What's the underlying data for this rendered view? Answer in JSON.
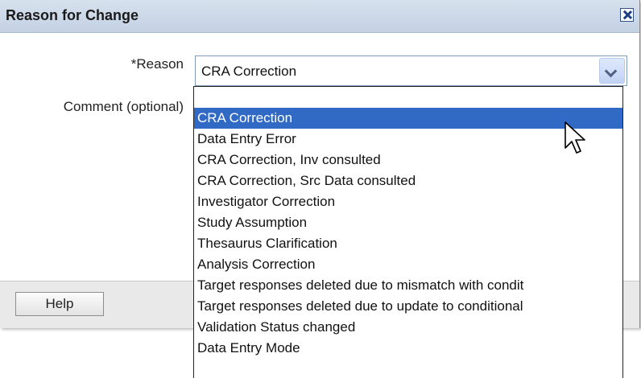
{
  "dialog": {
    "title": "Reason for Change",
    "close_icon": "close-icon"
  },
  "form": {
    "reason_label": "*Reason",
    "comment_label": "Comment (optional)",
    "reason_select": {
      "value": "CRA Correction",
      "arrow_icon": "chevron-down-icon"
    }
  },
  "dropdown": {
    "selected_index": 1,
    "options": [
      "",
      "CRA Correction",
      "Data Entry Error",
      "CRA Correction, Inv consulted",
      "CRA Correction, Src Data consulted",
      "Investigator Correction",
      "Study Assumption",
      "Thesaurus Clarification",
      "Analysis Correction",
      "Target responses deleted due to mismatch with condit",
      "Target responses deleted due to update to conditional",
      "Validation Status changed",
      "Data Entry Mode"
    ]
  },
  "footer": {
    "help_label": "Help"
  },
  "colors": {
    "selection": "#316ac5",
    "titlebar": "#c9d6e8"
  }
}
